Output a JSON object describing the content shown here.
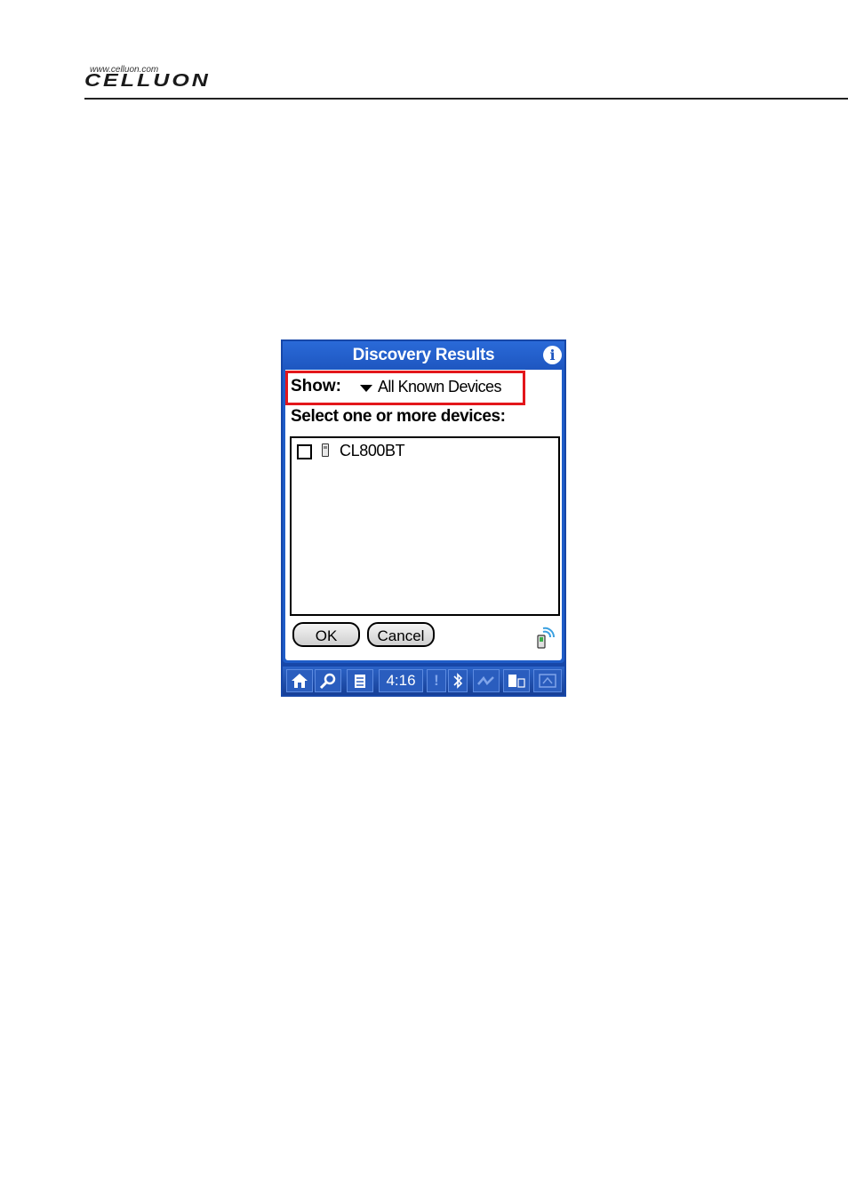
{
  "page_header": {
    "logo_url": "www.celluon.com",
    "logo_word": "CELLUON"
  },
  "dialog": {
    "title": "Discovery Results",
    "info_icon": "info-icon",
    "show_label": "Show:",
    "show_value": "All Known Devices",
    "select_label": "Select one or more devices:",
    "devices": [
      {
        "name": "CL800BT",
        "checked": false,
        "icon": "phone-icon"
      }
    ],
    "ok_label": "OK",
    "cancel_label": "Cancel"
  },
  "taskbar": {
    "time": "4:16",
    "icons": [
      "home-icon",
      "find-icon",
      "menu-icon",
      "alert-icon",
      "bluetooth-icon",
      "graffiti-icon",
      "device-icon",
      "signal-icon"
    ]
  },
  "colors": {
    "frame_blue": "#1e5cc8",
    "highlight_red": "#e3161b"
  }
}
